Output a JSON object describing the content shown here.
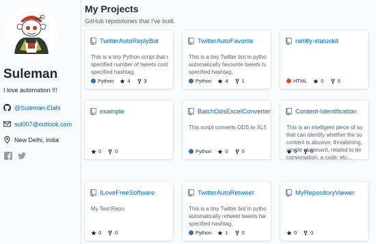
{
  "profile": {
    "name": "Suleman",
    "bio": "I love automation !!!",
    "github": "@Suleman-Elahi",
    "email": "sul007@outlook.com",
    "location": "New Delhi, india"
  },
  "main": {
    "title": "My Projects",
    "subtitle": "GitHub repositories that I've built."
  },
  "colors": {
    "python": "#3572A5",
    "html": "#e34c26",
    "link": "#0366d6"
  },
  "cards": [
    {
      "title": "TwitterAutoReplyBot",
      "desc": [
        "This is a tiny Python script that r",
        "specified number of tweets cont",
        "specified hashtag."
      ],
      "lang": "Python",
      "stars": "4",
      "forks": "3"
    },
    {
      "title": "TwitterAutoFavorite",
      "desc": [
        "This is a tiny Twitter bot in pythor",
        "automatically favourite tweets ha",
        "specified hashtag."
      ],
      "lang": "Python",
      "stars": "4",
      "forks": "1"
    },
    {
      "title": "netlify-statuskit",
      "desc": [],
      "lang": "HTML",
      "stars": "0",
      "forks": "0"
    },
    {
      "title": "example",
      "desc": [],
      "lang": "",
      "stars": "0",
      "forks": "0"
    },
    {
      "title": "BatchOdsExcelConverter",
      "desc": [
        "This script converts ODS to XLSX"
      ],
      "lang": "Python",
      "stars": "0",
      "forks": "0"
    },
    {
      "title": "Content-Identification",
      "desc": [
        "This is an intelligent piece of so",
        "that can identify whether the su",
        "content is abusive, threatening,",
        "simple statement, related to ter",
        "conversation, a code, etc..."
      ],
      "lang": "",
      "stars": "0",
      "forks": "0"
    },
    {
      "title": "ILoveFreeSoftware",
      "desc": [
        "My Test Repo"
      ],
      "lang": "",
      "stars": "0",
      "forks": "0"
    },
    {
      "title": "TwitterAutoRetweet",
      "desc": [
        "This is a tiny Twitter bot in pythor",
        "automatically retweet tweets hav",
        "specified hashtag."
      ],
      "lang": "Python",
      "stars": "1",
      "forks": "0"
    },
    {
      "title": "MyRepositoryViewer",
      "desc": [],
      "lang": "",
      "stars": "0",
      "forks": "0"
    }
  ]
}
